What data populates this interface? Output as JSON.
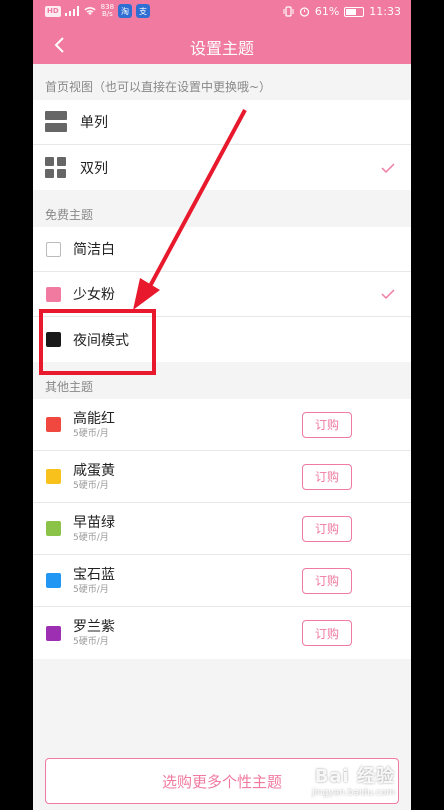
{
  "status_bar": {
    "carrier_chip": "HD",
    "net_speed_top": "838",
    "net_speed_bottom": "B/s",
    "app_icon_1": "淘",
    "app_icon_2": "支",
    "battery_percent": "61%",
    "battery_level": 0.61,
    "time": "11:33"
  },
  "header": {
    "title": "设置主题",
    "back_icon": "chevron-left-icon"
  },
  "home_view": {
    "section_title": "首页视图（也可以直接在设置中更换哦~）",
    "items": [
      {
        "label": "单列",
        "icon": "single-column-icon",
        "selected": false
      },
      {
        "label": "双列",
        "icon": "double-column-icon",
        "selected": true
      }
    ]
  },
  "free_themes": {
    "section_title": "免费主题",
    "items": [
      {
        "label": "简洁白",
        "color": "#ffffff",
        "selected": false
      },
      {
        "label": "少女粉",
        "color": "#f07aa0",
        "selected": true
      },
      {
        "label": "夜间模式",
        "color": "#1a1a1a",
        "selected": false
      }
    ]
  },
  "other_themes": {
    "section_title": "其他主题",
    "buy_label": "订购",
    "items": [
      {
        "label": "高能红",
        "price": "5硬币/月",
        "color": "#f0473e"
      },
      {
        "label": "咸蛋黄",
        "price": "5硬币/月",
        "color": "#f8c11b"
      },
      {
        "label": "早苗绿",
        "price": "5硬币/月",
        "color": "#8bc349"
      },
      {
        "label": "宝石蓝",
        "price": "5硬币/月",
        "color": "#2196f3"
      },
      {
        "label": "罗兰紫",
        "price": "5硬币/月",
        "color": "#9c2fb2"
      }
    ]
  },
  "footer": {
    "more_button": "选购更多个性主题"
  },
  "watermark": {
    "main": "Bai 经验",
    "sub": "jingyan.baidu.com"
  },
  "colors": {
    "accent": "#f07aa0",
    "annotation": "#e8192c"
  }
}
